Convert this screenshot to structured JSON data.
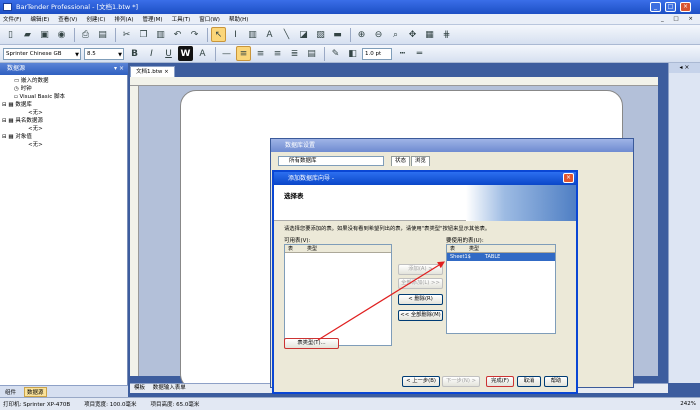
{
  "window": {
    "title": "BarTender Professional - [文档1.btw *]"
  },
  "menu": [
    "文件(F)",
    "编辑(E)",
    "查看(V)",
    "创建(C)",
    "排列(A)",
    "管理(M)",
    "工具(T)",
    "窗口(W)",
    "帮助(H)"
  ],
  "format_bar": {
    "font": "Sprinter Chinese GB",
    "size": "8.5",
    "line_width": "1.0 pt"
  },
  "left_panel": {
    "title": "数据源",
    "tree": [
      "嵌入的数据",
      "时钟",
      "Visual Basic 脚本",
      "数据库",
      "<无>",
      "具名数据源",
      "<无>",
      "对象值",
      "<无>"
    ],
    "tabs": [
      "组件",
      "数据源"
    ]
  },
  "document_tab": "文档1.btw",
  "page_tabs": [
    "模板",
    "数据输入表单"
  ],
  "status": {
    "printer": "打印机: Sprinter XP-470B",
    "width": "项目宽度: 100.0毫米",
    "height": "项目高度: 65.0毫米",
    "zoom": "242%"
  },
  "back_dialog": {
    "title": "数据库设置",
    "tree_item": "所有数据库",
    "tabs": [
      "状态",
      "浏览"
    ]
  },
  "wizard": {
    "title": "添加数据库向导 -",
    "heading": "选择表",
    "description": "请选择您要添加的表。如果没有看到希望列出的表，请使用\"表类型\"按钮来显示其他表。",
    "available_label": "可用表(V):",
    "selected_label": "要使用的表(U):",
    "col_table": "表",
    "col_type": "类型",
    "selected_rows": [
      {
        "table": "Sheet1$",
        "type": "TABLE"
      }
    ],
    "buttons": {
      "add": "添加(A) >",
      "add_all": "全部添加(L) >>",
      "remove": "< 删除(R)",
      "remove_all": "<< 全部删除(M)",
      "table_type": "表类型(T)...",
      "back": "< 上一步(B)",
      "next": "下一步(N) >",
      "finish": "完成(F)",
      "cancel": "取消",
      "help": "帮助"
    }
  },
  "colors": {
    "accent": "#0a46d4",
    "annotation": "#e02020"
  }
}
